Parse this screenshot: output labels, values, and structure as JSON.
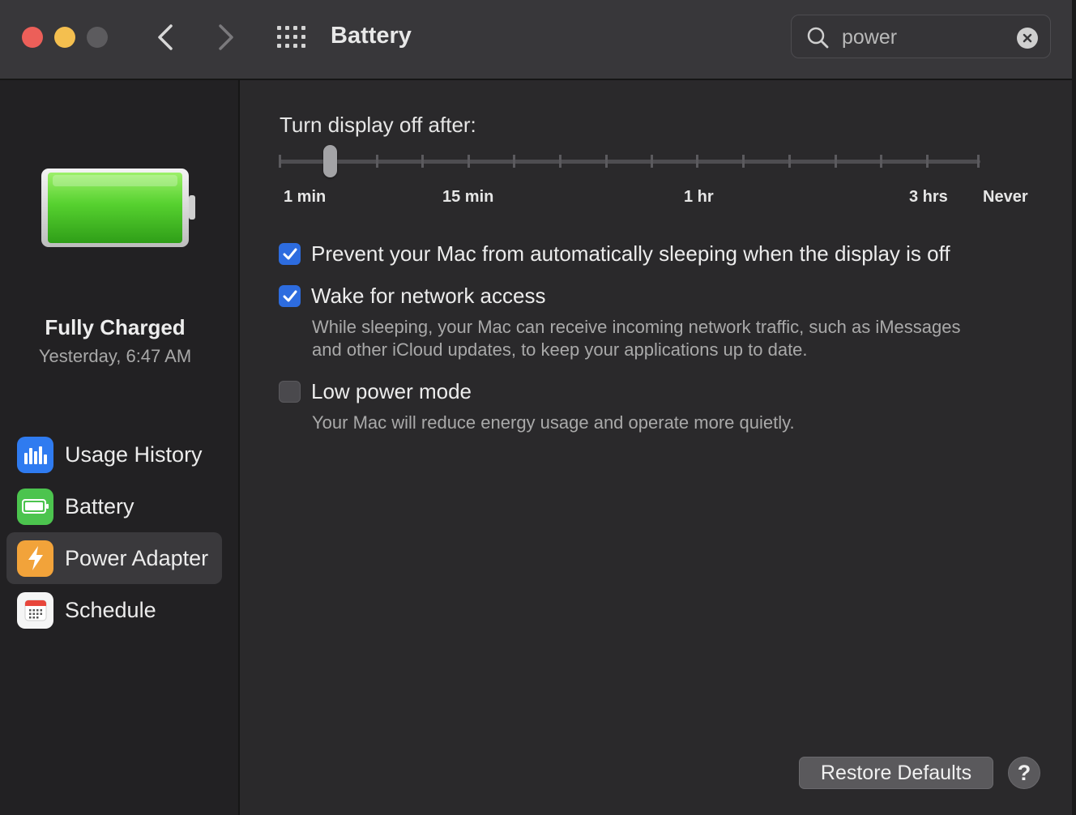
{
  "window": {
    "title": "Battery"
  },
  "search": {
    "value": "power"
  },
  "sidebar": {
    "status_title": "Fully Charged",
    "status_subtitle": "Yesterday, 6:47 AM",
    "items": [
      {
        "label": "Usage History",
        "icon": "bar-chart-icon",
        "color": "#2f7bf0",
        "selected": false
      },
      {
        "label": "Battery",
        "icon": "battery-icon",
        "color": "#4cc44e",
        "selected": false
      },
      {
        "label": "Power Adapter",
        "icon": "lightning-bolt-icon",
        "color": "#f2a33a",
        "selected": true
      },
      {
        "label": "Schedule",
        "icon": "calendar-icon",
        "color": "#f5f5f5",
        "selected": false
      }
    ]
  },
  "display_off": {
    "label": "Turn display off after:",
    "tick_labels": [
      "1 min",
      "15 min",
      "1 hr",
      "3 hrs",
      "Never"
    ],
    "value": "2 min"
  },
  "options": [
    {
      "label": "Prevent your Mac from automatically sleeping when the display is off",
      "checked": true,
      "description": ""
    },
    {
      "label": "Wake for network access",
      "checked": true,
      "description_lines": [
        "While sleeping, your Mac can receive incoming network traffic, such as iMessages",
        "and other iCloud updates, to keep your applications up to date."
      ]
    },
    {
      "label": "Low power mode",
      "checked": false,
      "description": "Your Mac will reduce energy usage and operate more quietly."
    }
  ],
  "footer": {
    "restore_label": "Restore Defaults",
    "help_label": "?"
  },
  "colors": {
    "accent": "#2d6cdf",
    "battery_fill": "#4cd137"
  }
}
